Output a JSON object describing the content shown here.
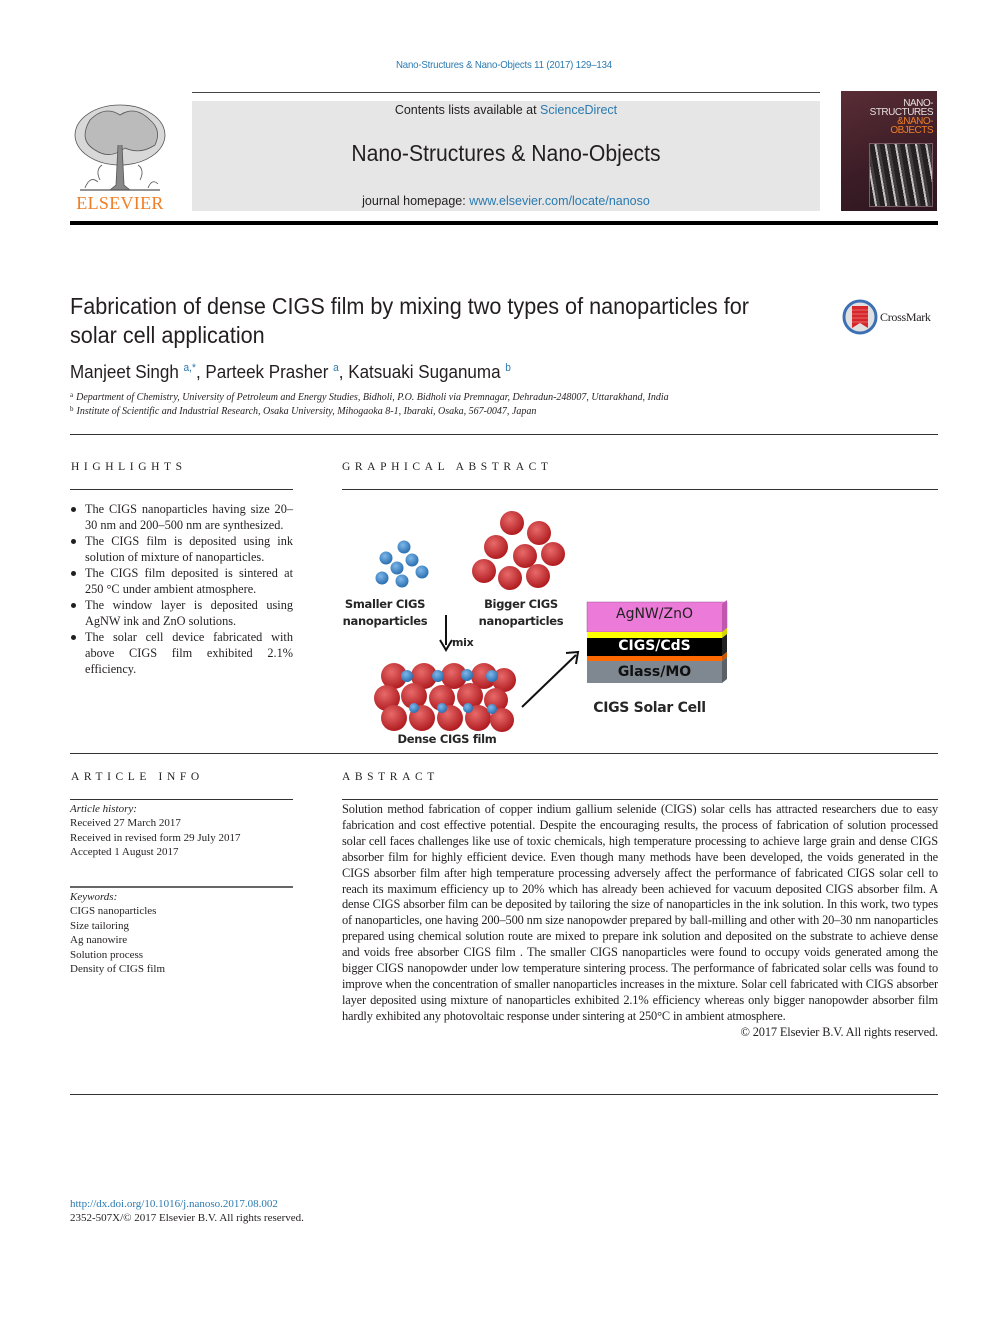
{
  "journal_ref": "Nano-Structures & Nano-Objects 11 (2017) 129–134",
  "header": {
    "publisher_logo_icon": "elsevier-tree-logo",
    "publisher_name": "ELSEVIER",
    "contents_prefix": "Contents lists available at ",
    "contents_link": "ScienceDirect",
    "journal_name": "Nano-Structures & Nano-Objects",
    "homepage_prefix": "journal homepage: ",
    "homepage_link": "www.elsevier.com/locate/nanoso",
    "cover": {
      "line1": "NANO-",
      "line2": "STRUCTURES",
      "line3": "&NANO-",
      "line4": "OBJECTS",
      "accent_color": "#f07e26"
    }
  },
  "article": {
    "title": "Fabrication of dense CIGS film by mixing two types of nanoparticles for solar cell application",
    "crossmark_label": "CrossMark",
    "authors": [
      {
        "name": "Manjeet Singh",
        "sup": "a,*"
      },
      {
        "name": "Parteek Prasher",
        "sup": "a"
      },
      {
        "name": "Katsuaki Suganuma",
        "sup": "b"
      }
    ],
    "affiliations": [
      {
        "sup": "a",
        "text": "Department of Chemistry, University of Petroleum and Energy Studies, Bidholi, P.O. Bidholi via Premnagar, Dehradun-248007, Uttarakhand, India"
      },
      {
        "sup": "b",
        "text": "Institute of Scientific and Industrial Research, Osaka University, Mihogaoka 8-1, Ibaraki, Osaka, 567-0047, Japan"
      }
    ]
  },
  "highlights": {
    "heading": "HIGHLIGHTS",
    "items": [
      "The CIGS nanoparticles having size 20–30 nm and 200–500 nm are synthesized.",
      "The CIGS film is deposited using ink solution of mixture of nanoparticles.",
      "The CIGS film deposited is sintered at 250 °C under ambient atmosphere.",
      "The window layer is deposited using AgNW ink and ZnO solutions.",
      "The solar cell device fabricated with above CIGS film exhibited 2.1% efficiency."
    ]
  },
  "graphical_abstract": {
    "heading": "GRAPHICAL ABSTRACT",
    "smaller_label_1": "Smaller CIGS",
    "smaller_label_2": "nanoparticles",
    "bigger_label_1": "Bigger CIGS",
    "bigger_label_2": "nanoparticles",
    "mix_label": "mix",
    "dense_label": "Dense CIGS film",
    "layers": [
      "AgNW/ZnO",
      "CIGS/CdS",
      "Glass/MO"
    ],
    "cell_label": "CIGS Solar Cell",
    "colors": {
      "small_particle": "#3a86c8",
      "big_particle": "#c8282c",
      "agnw": "#ec7ad8",
      "cds": "#ffff00",
      "cigs": "#000000",
      "mo": "#ff6a00",
      "glass": "#7f8790"
    }
  },
  "article_info": {
    "heading": "ARTICLE INFO",
    "history_label": "Article history:",
    "history": [
      "Received 27 March 2017",
      "Received in revised form 29 July 2017",
      "Accepted 1 August 2017"
    ],
    "keywords_label": "Keywords:",
    "keywords": [
      "CIGS nanoparticles",
      "Size tailoring",
      "Ag nanowire",
      "Solution process",
      "Density of CIGS film"
    ]
  },
  "abstract": {
    "heading": "ABSTRACT",
    "text": "Solution method fabrication of copper indium gallium selenide (CIGS) solar cells has attracted researchers due to easy fabrication and cost effective potential. Despite the encouraging results, the process of fabrication of solution processed solar cell faces challenges like use of toxic chemicals, high temperature processing to achieve large grain and dense CIGS absorber film for highly efficient device. Even though many methods have been developed, the voids generated in the CIGS absorber film after high temperature processing adversely affect the performance of fabricated CIGS solar cell to reach its maximum efficiency up to 20% which has already been achieved for vacuum deposited CIGS absorber film. A dense CIGS absorber film can be deposited by tailoring the size of nanoparticles in the ink solution. In this work, two types of nanoparticles, one having 200–500 nm size nanopowder prepared by ball-milling and other with 20–30 nm nanoparticles prepared using chemical solution route are mixed to prepare ink solution and deposited on the substrate to achieve dense and voids free absorber CIGS film . The smaller CIGS nanoparticles were found to occupy voids generated among the bigger CIGS nanopowder under low temperature sintering process. The performance of fabricated solar cells was found to improve when the concentration of smaller nanoparticles increases in the mixture. Solar cell fabricated with CIGS absorber layer deposited using mixture of nanoparticles exhibited 2.1% efficiency whereas only bigger nanopowder absorber film hardly exhibited any photovoltaic response under sintering at 250°C in ambient atmosphere.",
    "copyright": "© 2017 Elsevier B.V. All rights reserved."
  },
  "footer": {
    "doi": "http://dx.doi.org/10.1016/j.nanoso.2017.08.002",
    "issn_line": "2352-507X/© 2017 Elsevier B.V. All rights reserved."
  }
}
